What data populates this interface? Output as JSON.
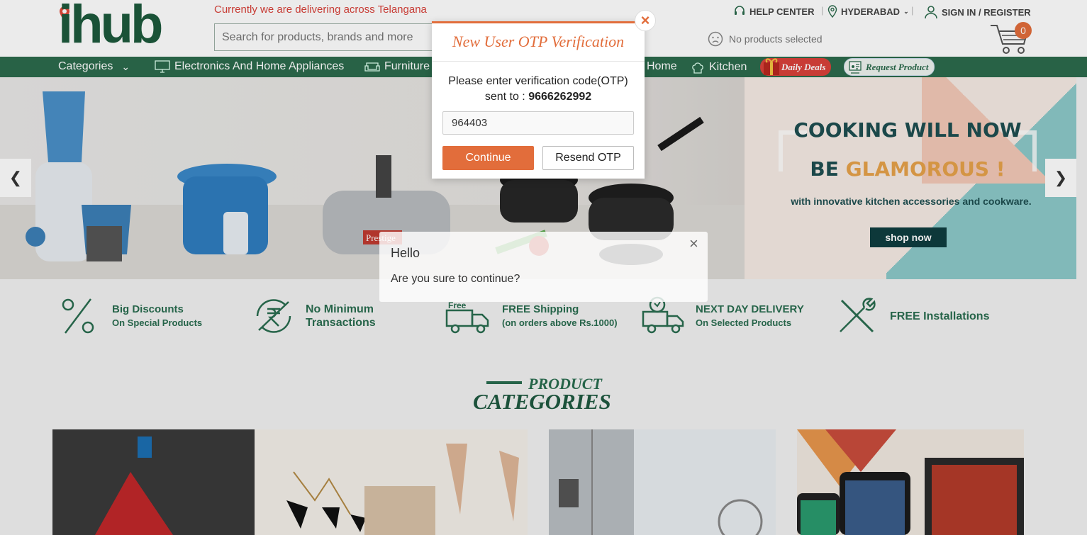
{
  "header": {
    "logo_text": "ihub",
    "delivery_notice": "Currently we are delivering across Telangana",
    "search_placeholder": "Search for products, brands and more",
    "help_center": "HELP CENTER",
    "location": "HYDERABAD",
    "sign_in": "SIGN IN / REGISTER",
    "no_products": "No products selected",
    "cart_count": "0"
  },
  "nav": {
    "categories": "Categories",
    "items": [
      "Electronics And Home Appliances",
      "Furniture",
      "Home",
      "Kitchen"
    ],
    "daily_deals": "Daily Deals",
    "request_product": "Request Product"
  },
  "banner": {
    "line1": "COOKING WILL NOW",
    "line2a": "BE ",
    "line2b": "GLAMOROUS !",
    "sub": "with innovative kitchen accessories and cookware.",
    "button": "shop now",
    "prestige": "Prestige"
  },
  "features": [
    {
      "title": "Big Discounts",
      "sub": "On Special Products"
    },
    {
      "title": "No Minimum",
      "sub": "Transactions"
    },
    {
      "title": "FREE Shipping",
      "sub": "(on orders above Rs.1000)"
    },
    {
      "title": "NEXT DAY DELIVERY",
      "sub": "On Selected Products"
    },
    {
      "title": "FREE Installations",
      "sub": ""
    }
  ],
  "free_badge": "Free",
  "product_categories": {
    "top": "PRODUCT",
    "bottom": "CATEGORIES"
  },
  "otp_modal": {
    "title": "New User OTP Verification",
    "message": "Please enter verification code(OTP)",
    "sent_to_label": "sent to : ",
    "phone": "9666262992",
    "otp_value": "964403",
    "continue": "Continue",
    "resend": "Resend OTP",
    "close": "×"
  },
  "toast": {
    "title": "Hello",
    "message": "Are you sure to continue?",
    "close": "×"
  },
  "colors": {
    "brand_green": "#2c6b4d",
    "accent_orange": "#e26d3b",
    "delivery_red": "#d9423a"
  }
}
